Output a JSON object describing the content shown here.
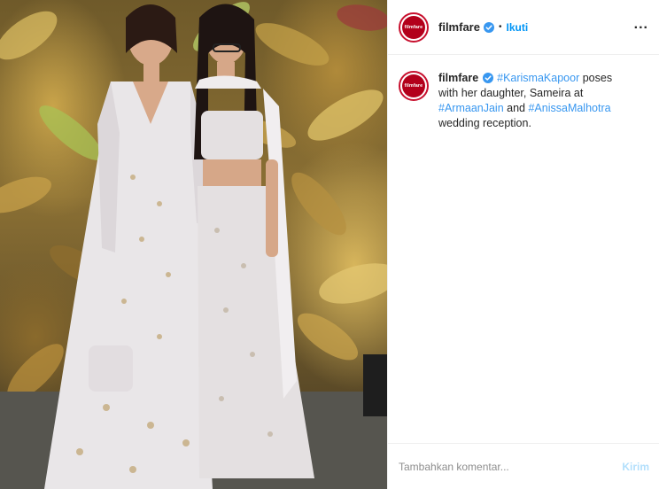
{
  "post": {
    "photo_alt": "Karisma Kapoor and daughter Sameira at wedding reception",
    "dress_colors": {
      "mother": "#e9e6e8",
      "daughter": "#e4e0e1",
      "background_gold": "#b8923f"
    }
  },
  "header": {
    "username": "filmfare",
    "avatar_text": "filmfare",
    "separator": "•",
    "follow_label": "Ikuti",
    "more_icon": "..."
  },
  "caption": {
    "username": "filmfare",
    "avatar_text": "filmfare",
    "tag1": "#KarismaKapoor",
    "text1": " poses with her daughter, Sameira at ",
    "tag2": "#ArmaanJain",
    "text2": " and ",
    "tag3": "#AnissaMalhotra",
    "text3": " wedding reception."
  },
  "comment": {
    "placeholder": "Tambahkan komentar...",
    "send_label": "Kirim"
  },
  "colors": {
    "link_blue": "#0095f6",
    "hashtag": "#3897f0",
    "brand_red": "#b3001b"
  }
}
